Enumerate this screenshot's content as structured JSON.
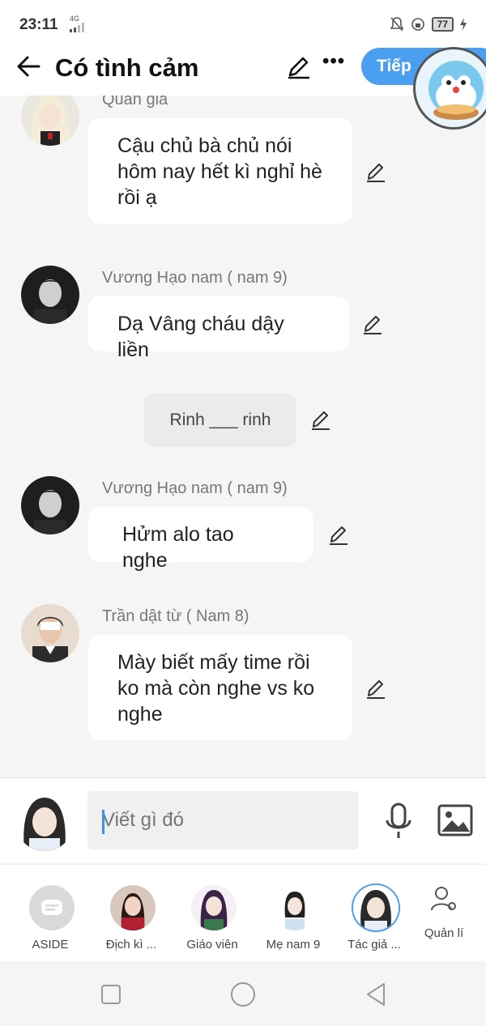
{
  "status_bar": {
    "time": "23:11",
    "network": "4G",
    "battery": "77"
  },
  "header": {
    "title": "Có tình cảm",
    "next_label": "Tiếp",
    "icons": [
      "back-arrow-icon",
      "pencil-icon",
      "more-icon"
    ]
  },
  "messages": [
    {
      "sender": "Quản gia",
      "text": "Cậu chủ bà chủ nói hôm nay hết kì nghỉ hè rồi ạ"
    },
    {
      "sender": "Vương Hạo nam ( nam 9)",
      "text": "Dạ Vâng cháu dậy liền"
    },
    {
      "narration": "Rinh ___ rinh"
    },
    {
      "sender": "Vương Hạo nam ( nam 9)",
      "text": "Hửm alo tao nghe"
    },
    {
      "sender": "Trần dật từ ( Nam 8)",
      "text": "Mày biết mấy time rồi ko mà còn nghe vs ko nghe"
    }
  ],
  "input": {
    "placeholder": "Viết gì đó"
  },
  "characters": [
    {
      "label": "ASIDE"
    },
    {
      "label": "Địch kì ..."
    },
    {
      "label": "Giáo viên"
    },
    {
      "label": "Mẹ nam 9"
    },
    {
      "label": "Tác giả ..."
    },
    {
      "label": "Quản lí"
    }
  ],
  "colors": {
    "accent": "#4a9ff0",
    "background": "#f5f5f5",
    "bubble": "#ffffff"
  }
}
